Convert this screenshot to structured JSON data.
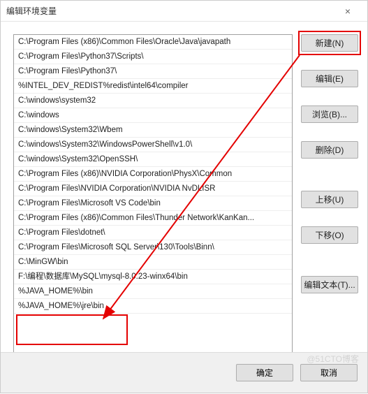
{
  "window": {
    "title": "编辑环境变量",
    "close_glyph": "×"
  },
  "paths": [
    "C:\\Program Files (x86)\\Common Files\\Oracle\\Java\\javapath",
    "C:\\Program Files\\Python37\\Scripts\\",
    "C:\\Program Files\\Python37\\",
    "%INTEL_DEV_REDIST%redist\\intel64\\compiler",
    "C:\\windows\\system32",
    "C:\\windows",
    "C:\\windows\\System32\\Wbem",
    "C:\\windows\\System32\\WindowsPowerShell\\v1.0\\",
    "C:\\windows\\System32\\OpenSSH\\",
    "C:\\Program Files (x86)\\NVIDIA Corporation\\PhysX\\Common",
    "C:\\Program Files\\NVIDIA Corporation\\NVIDIA NvDLISR",
    "C:\\Program Files\\Microsoft VS Code\\bin",
    "C:\\Program Files (x86)\\Common Files\\Thunder Network\\KanKan...",
    "C:\\Program Files\\dotnet\\",
    "C:\\Program Files\\Microsoft SQL Server\\130\\Tools\\Binn\\",
    "C:\\MinGW\\bin",
    "F:\\编程\\数据库\\MySQL\\mysql-8.0.23-winx64\\bin",
    "%JAVA_HOME%\\bin",
    "%JAVA_HOME%\\jre\\bin"
  ],
  "buttons": {
    "new": "新建(N)",
    "edit": "编辑(E)",
    "browse": "浏览(B)...",
    "delete": "删除(D)",
    "moveup": "上移(U)",
    "movedown": "下移(O)",
    "edittext": "编辑文本(T)...",
    "ok": "确定",
    "cancel": "取消"
  },
  "watermark": "@51CTO博客"
}
